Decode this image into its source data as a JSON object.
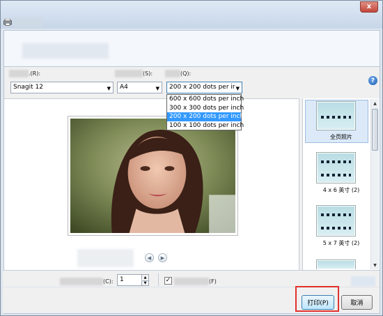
{
  "window": {
    "close_symbol": "x",
    "help_symbol": "?"
  },
  "settings": {
    "printer_label": ".(R):",
    "paper_label": "(S):",
    "quality_label": "(Q):",
    "printer_value": "Snagit 12",
    "paper_value": "A4",
    "quality_value": "200 x 200 dots per ir",
    "quality_options": [
      "600 x 600 dots per inch",
      "300 x 300 dots per inch",
      "200 x 200 dots per inch",
      "100 x 100 dots per inch"
    ],
    "quality_selected_index": 2
  },
  "layouts": [
    {
      "label": "全页照片"
    },
    {
      "label": "4 x 6 英寸 (2)"
    },
    {
      "label": "5 x 7 英寸 (2)"
    }
  ],
  "bottom": {
    "copies_label": "(C):",
    "copies_value": "1",
    "fit_label": "(F)",
    "fit_checked_symbol": "✓"
  },
  "buttons": {
    "print": "打印(P)",
    "cancel": "取消"
  },
  "nav": {
    "prev_symbol": "◀",
    "next_symbol": "▶"
  },
  "colors": {
    "selected_item": "#3399ff",
    "highlight_box": "#e0312d"
  }
}
